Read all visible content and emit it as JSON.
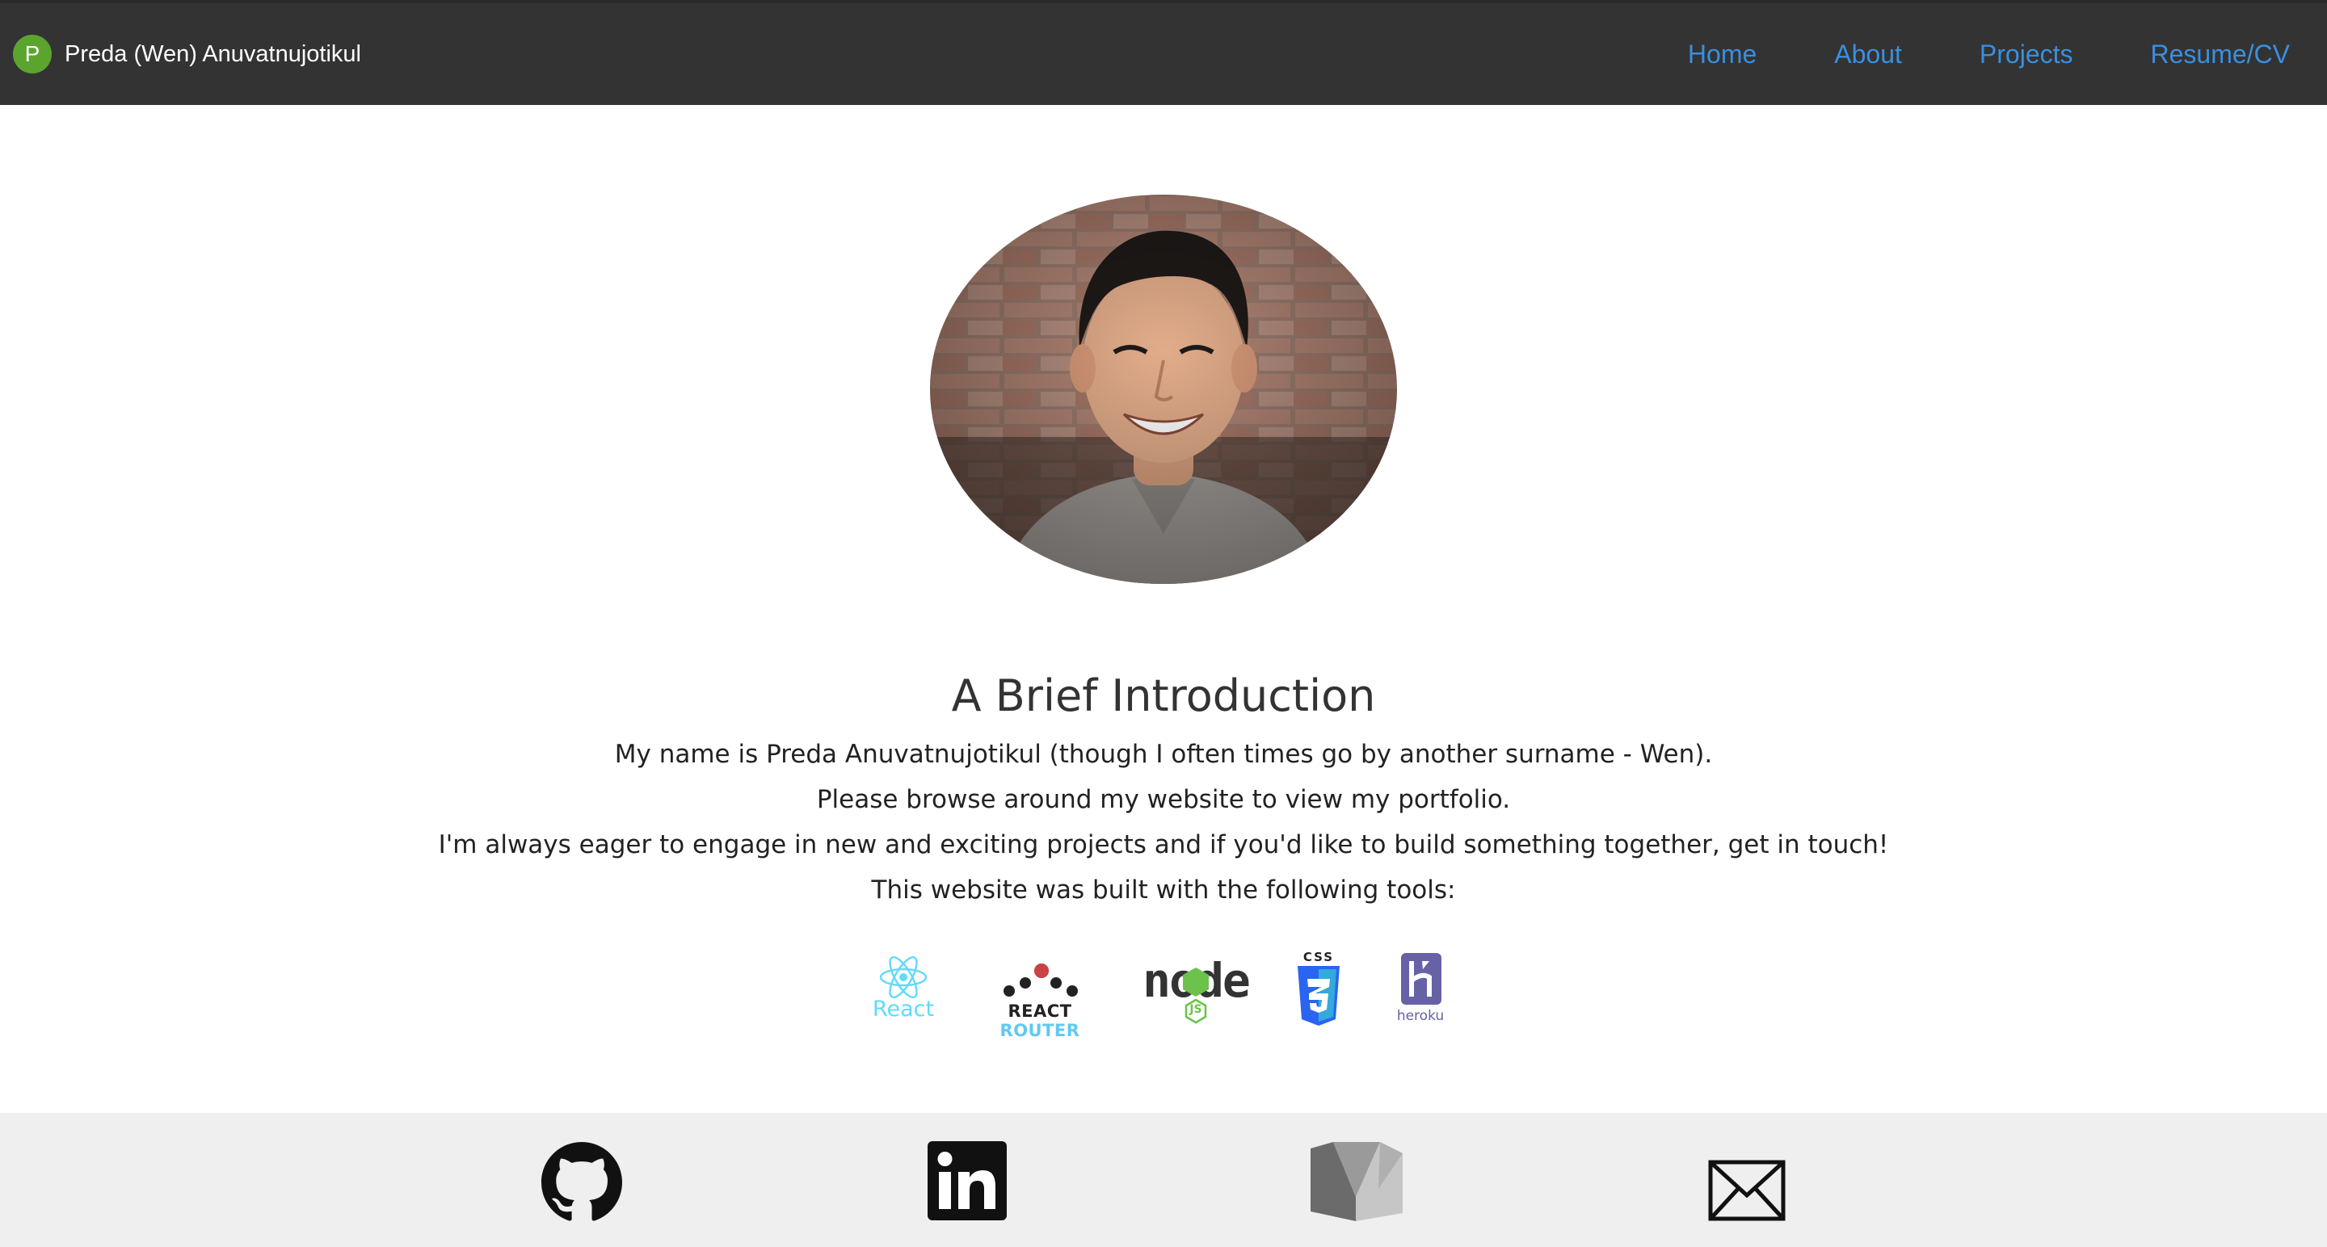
{
  "navbar": {
    "brand_initial": "P",
    "brand_name": "Preda (Wen) Anuvatnujotikul",
    "links": [
      "Home",
      "About",
      "Projects",
      "Resume/CV"
    ]
  },
  "intro": {
    "title": "A Brief Introduction",
    "lines": [
      "My name is Preda Anuvatnujotikul (though I often times go by another surname - Wen).",
      "Please browse around my website to view my portfolio.",
      "I'm always eager to engage in new and exciting projects and if you'd like to build something together, get in touch!",
      "This website was built with the following tools:"
    ]
  },
  "tools": {
    "react": "React",
    "react_router_1": "REACT",
    "react_router_2": "ROUTER",
    "node_label": "node",
    "node_js": "JS",
    "css3_label": "CSS",
    "heroku": "heroku"
  },
  "footer": {
    "icons": [
      "github-icon",
      "linkedin-icon",
      "medium-icon",
      "envelope-icon"
    ]
  },
  "colors": {
    "navbar_bg": "#333333",
    "brand_green": "#5ba52e",
    "nav_link": "#3a8fe0",
    "footer_bg": "#efefef",
    "react_cyan": "#61dafb",
    "node_green": "#6cc24a",
    "css3_blue": "#2965f1",
    "heroku_purple": "#6762a6"
  }
}
